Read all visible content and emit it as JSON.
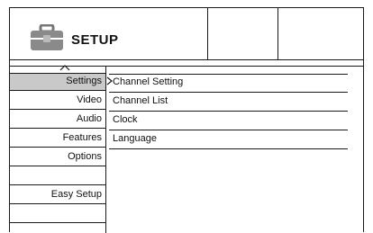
{
  "header": {
    "title": "SETUP",
    "icon": "toolbox-icon"
  },
  "left_menu": {
    "items": [
      {
        "label": "Settings",
        "selected": true
      },
      {
        "label": "Video"
      },
      {
        "label": "Audio"
      },
      {
        "label": "Features"
      },
      {
        "label": "Options"
      },
      {
        "label": ""
      },
      {
        "label": "Easy Setup"
      },
      {
        "label": ""
      },
      {
        "label": ""
      }
    ]
  },
  "right_menu": {
    "items": [
      {
        "label": "Channel Setting"
      },
      {
        "label": "Channel List"
      },
      {
        "label": "Clock"
      },
      {
        "label": "Language"
      }
    ]
  },
  "colors": {
    "selected_bg": "#c9c9c9",
    "line": "#1a1a1a"
  }
}
